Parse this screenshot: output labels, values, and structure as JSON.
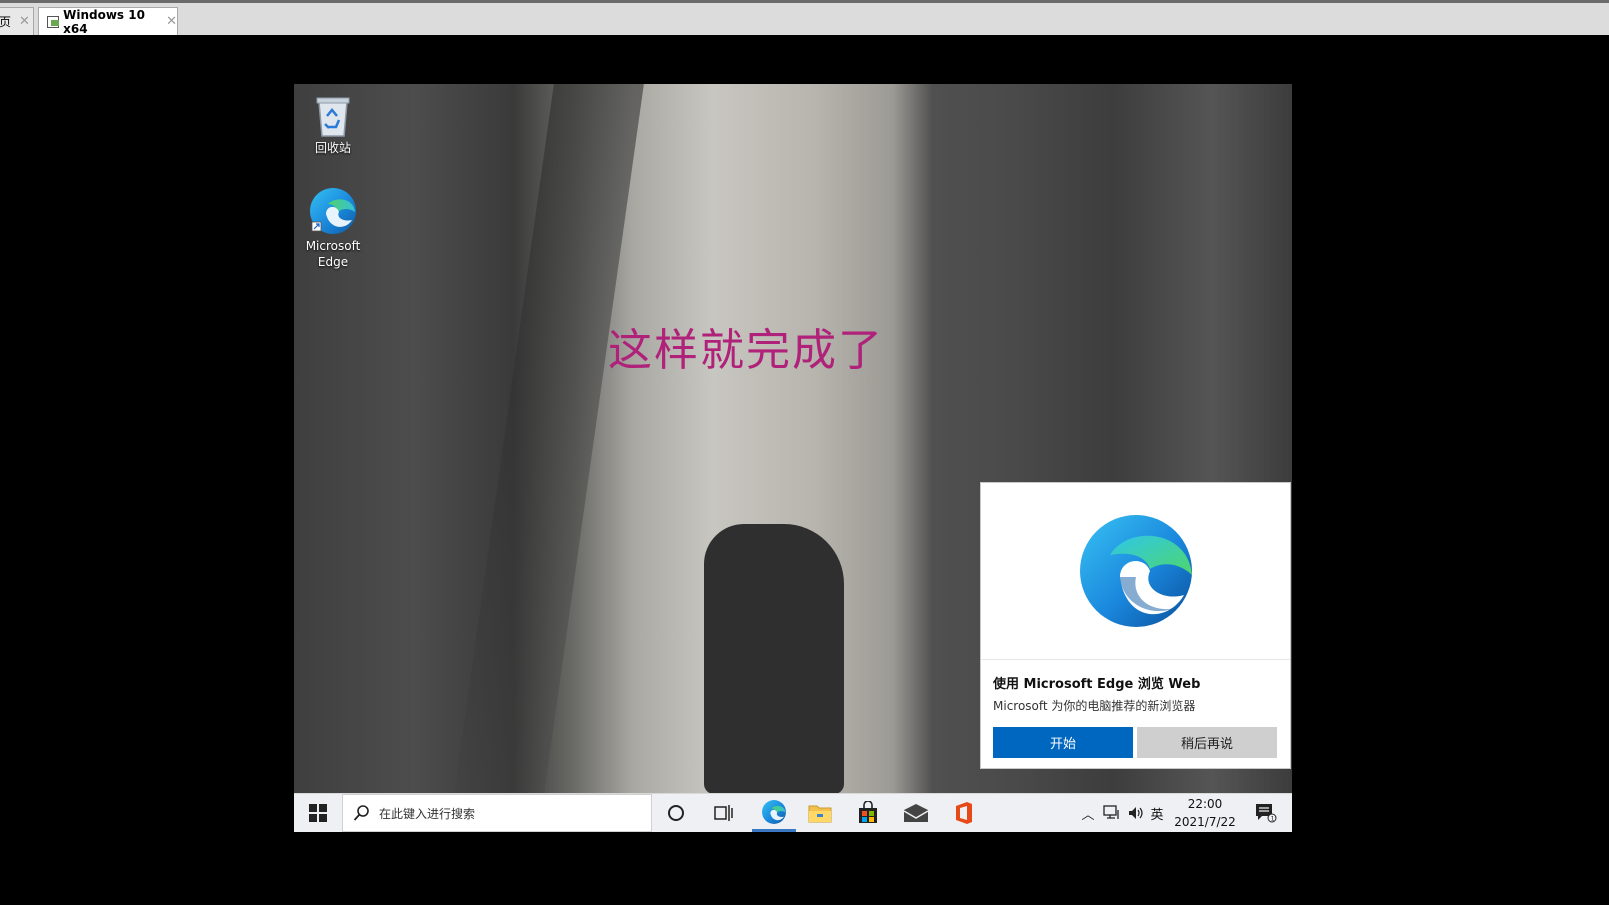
{
  "tabs": [
    {
      "label": "页"
    },
    {
      "label": "Windows 10 x64"
    }
  ],
  "desktop": {
    "icons": [
      {
        "label": "回收站"
      },
      {
        "label": "Microsoft Edge"
      }
    ],
    "overlay_text": "这样就完成了"
  },
  "toast": {
    "title": "使用 Microsoft Edge 浏览 Web",
    "body": "Microsoft 为你的电脑推荐的新浏览器",
    "primary_button": "开始",
    "secondary_button": "稍后再说",
    "primary_color": "#0067c0"
  },
  "taskbar": {
    "search_placeholder": "在此键入进行搜索",
    "ime_label": "英",
    "time": "22:00",
    "date": "2021/7/22",
    "pinned_apps": [
      "edge-icon",
      "file-explorer-icon",
      "store-icon",
      "mail-icon",
      "office-icon"
    ]
  },
  "colors": {
    "overlay_text": "#b0217a",
    "taskbar_bg": "#eef0f4"
  }
}
